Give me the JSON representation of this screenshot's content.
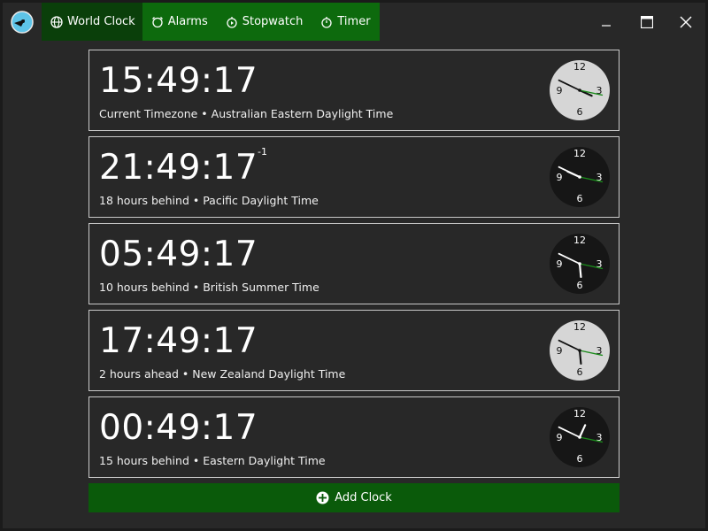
{
  "tabs": [
    {
      "label": "World Clock",
      "icon": "globe-icon",
      "active": true
    },
    {
      "label": "Alarms",
      "icon": "alarm-icon",
      "active": false
    },
    {
      "label": "Stopwatch",
      "icon": "stopwatch-icon",
      "active": false
    },
    {
      "label": "Timer",
      "icon": "timer-icon",
      "active": false
    }
  ],
  "clocks": [
    {
      "time": "15:49:17",
      "offset": "",
      "description": "Current Timezone • Australian Eastern Daylight Time",
      "face": "light"
    },
    {
      "time": "21:49:17",
      "offset": "-1",
      "description": "18 hours behind • Pacific Daylight Time",
      "face": "dark"
    },
    {
      "time": "05:49:17",
      "offset": "",
      "description": "10 hours behind • British Summer Time",
      "face": "dark"
    },
    {
      "time": "17:49:17",
      "offset": "",
      "description": "2 hours ahead • New Zealand Daylight Time",
      "face": "light"
    },
    {
      "time": "00:49:17",
      "offset": "",
      "description": "15 hours behind • Eastern Daylight Time",
      "face": "dark"
    }
  ],
  "dial_labels": [
    "12",
    "3",
    "6",
    "9"
  ],
  "add_clock_label": "Add Clock",
  "colors": {
    "accent": "#0d6a0d",
    "active_tab": "#0a3f0a",
    "add_button": "#0a5a0a",
    "background": "#282828",
    "second_hand": "#1a8a1a"
  }
}
